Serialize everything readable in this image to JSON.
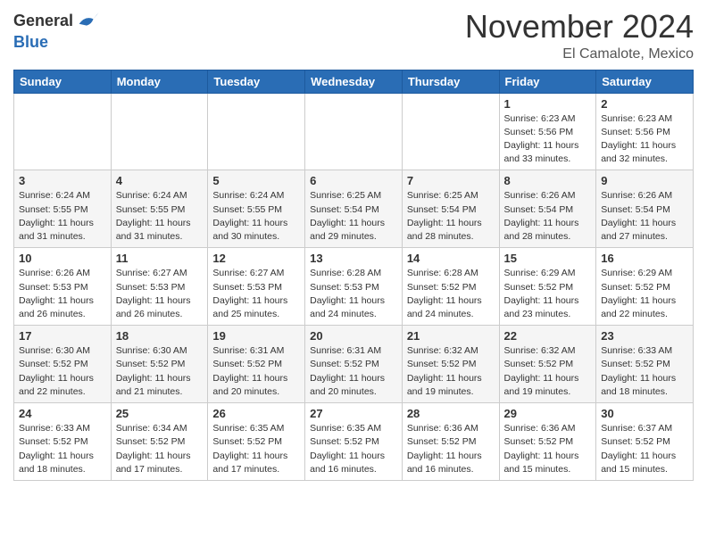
{
  "header": {
    "logo_general": "General",
    "logo_blue": "Blue",
    "month_title": "November 2024",
    "location": "El Camalote, Mexico"
  },
  "weekdays": [
    "Sunday",
    "Monday",
    "Tuesday",
    "Wednesday",
    "Thursday",
    "Friday",
    "Saturday"
  ],
  "weeks": [
    [
      {
        "day": "",
        "info": ""
      },
      {
        "day": "",
        "info": ""
      },
      {
        "day": "",
        "info": ""
      },
      {
        "day": "",
        "info": ""
      },
      {
        "day": "",
        "info": ""
      },
      {
        "day": "1",
        "info": "Sunrise: 6:23 AM\nSunset: 5:56 PM\nDaylight: 11 hours and 33 minutes."
      },
      {
        "day": "2",
        "info": "Sunrise: 6:23 AM\nSunset: 5:56 PM\nDaylight: 11 hours and 32 minutes."
      }
    ],
    [
      {
        "day": "3",
        "info": "Sunrise: 6:24 AM\nSunset: 5:55 PM\nDaylight: 11 hours and 31 minutes."
      },
      {
        "day": "4",
        "info": "Sunrise: 6:24 AM\nSunset: 5:55 PM\nDaylight: 11 hours and 31 minutes."
      },
      {
        "day": "5",
        "info": "Sunrise: 6:24 AM\nSunset: 5:55 PM\nDaylight: 11 hours and 30 minutes."
      },
      {
        "day": "6",
        "info": "Sunrise: 6:25 AM\nSunset: 5:54 PM\nDaylight: 11 hours and 29 minutes."
      },
      {
        "day": "7",
        "info": "Sunrise: 6:25 AM\nSunset: 5:54 PM\nDaylight: 11 hours and 28 minutes."
      },
      {
        "day": "8",
        "info": "Sunrise: 6:26 AM\nSunset: 5:54 PM\nDaylight: 11 hours and 28 minutes."
      },
      {
        "day": "9",
        "info": "Sunrise: 6:26 AM\nSunset: 5:54 PM\nDaylight: 11 hours and 27 minutes."
      }
    ],
    [
      {
        "day": "10",
        "info": "Sunrise: 6:26 AM\nSunset: 5:53 PM\nDaylight: 11 hours and 26 minutes."
      },
      {
        "day": "11",
        "info": "Sunrise: 6:27 AM\nSunset: 5:53 PM\nDaylight: 11 hours and 26 minutes."
      },
      {
        "day": "12",
        "info": "Sunrise: 6:27 AM\nSunset: 5:53 PM\nDaylight: 11 hours and 25 minutes."
      },
      {
        "day": "13",
        "info": "Sunrise: 6:28 AM\nSunset: 5:53 PM\nDaylight: 11 hours and 24 minutes."
      },
      {
        "day": "14",
        "info": "Sunrise: 6:28 AM\nSunset: 5:52 PM\nDaylight: 11 hours and 24 minutes."
      },
      {
        "day": "15",
        "info": "Sunrise: 6:29 AM\nSunset: 5:52 PM\nDaylight: 11 hours and 23 minutes."
      },
      {
        "day": "16",
        "info": "Sunrise: 6:29 AM\nSunset: 5:52 PM\nDaylight: 11 hours and 22 minutes."
      }
    ],
    [
      {
        "day": "17",
        "info": "Sunrise: 6:30 AM\nSunset: 5:52 PM\nDaylight: 11 hours and 22 minutes."
      },
      {
        "day": "18",
        "info": "Sunrise: 6:30 AM\nSunset: 5:52 PM\nDaylight: 11 hours and 21 minutes."
      },
      {
        "day": "19",
        "info": "Sunrise: 6:31 AM\nSunset: 5:52 PM\nDaylight: 11 hours and 20 minutes."
      },
      {
        "day": "20",
        "info": "Sunrise: 6:31 AM\nSunset: 5:52 PM\nDaylight: 11 hours and 20 minutes."
      },
      {
        "day": "21",
        "info": "Sunrise: 6:32 AM\nSunset: 5:52 PM\nDaylight: 11 hours and 19 minutes."
      },
      {
        "day": "22",
        "info": "Sunrise: 6:32 AM\nSunset: 5:52 PM\nDaylight: 11 hours and 19 minutes."
      },
      {
        "day": "23",
        "info": "Sunrise: 6:33 AM\nSunset: 5:52 PM\nDaylight: 11 hours and 18 minutes."
      }
    ],
    [
      {
        "day": "24",
        "info": "Sunrise: 6:33 AM\nSunset: 5:52 PM\nDaylight: 11 hours and 18 minutes."
      },
      {
        "day": "25",
        "info": "Sunrise: 6:34 AM\nSunset: 5:52 PM\nDaylight: 11 hours and 17 minutes."
      },
      {
        "day": "26",
        "info": "Sunrise: 6:35 AM\nSunset: 5:52 PM\nDaylight: 11 hours and 17 minutes."
      },
      {
        "day": "27",
        "info": "Sunrise: 6:35 AM\nSunset: 5:52 PM\nDaylight: 11 hours and 16 minutes."
      },
      {
        "day": "28",
        "info": "Sunrise: 6:36 AM\nSunset: 5:52 PM\nDaylight: 11 hours and 16 minutes."
      },
      {
        "day": "29",
        "info": "Sunrise: 6:36 AM\nSunset: 5:52 PM\nDaylight: 11 hours and 15 minutes."
      },
      {
        "day": "30",
        "info": "Sunrise: 6:37 AM\nSunset: 5:52 PM\nDaylight: 11 hours and 15 minutes."
      }
    ]
  ]
}
